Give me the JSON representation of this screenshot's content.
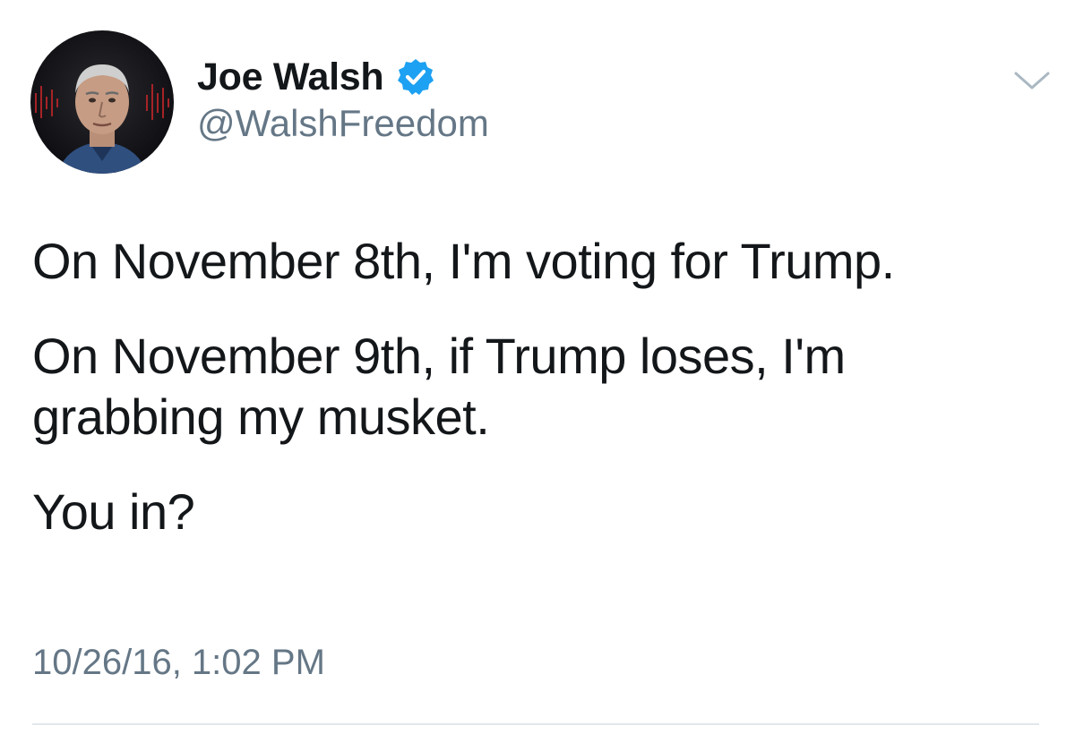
{
  "author": {
    "display_name": "Joe Walsh",
    "handle": "@WalshFreedom",
    "verified": true,
    "avatar_icon": "profile-photo"
  },
  "tweet": {
    "paragraphs": [
      "On November 8th, I'm voting for Trump.",
      "On November 9th, if Trump loses, I'm grabbing my musket.",
      "You in?"
    ],
    "timestamp": "10/26/16, 1:02 PM"
  },
  "icons": {
    "verified": "verified-badge-icon",
    "menu": "chevron-down-icon"
  },
  "colors": {
    "verified_blue": "#1da1f2",
    "secondary_text": "#657786",
    "primary_text": "#14171a",
    "divider": "#e1e8ed"
  }
}
